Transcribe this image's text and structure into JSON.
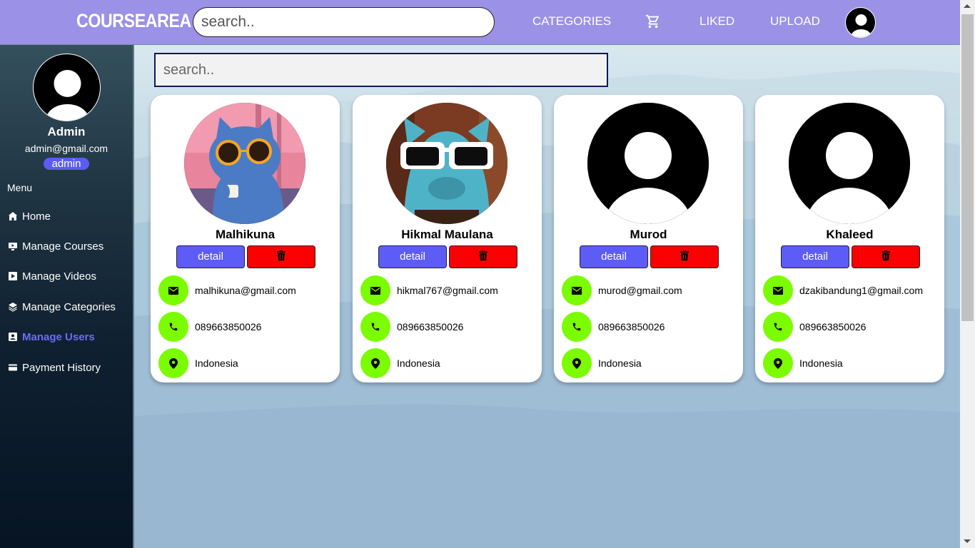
{
  "navbar": {
    "logo": "COURSEAREA",
    "search_placeholder": "search..",
    "links": {
      "categories": "CATEGORIES",
      "liked": "LIKED",
      "upload": "UPLOAD"
    },
    "cart_icon": "cart-icon",
    "color": "#9b91e6"
  },
  "sidebar": {
    "user": {
      "name": "Admin",
      "email": "admin@gmail.com",
      "role": "admin"
    },
    "menu_title": "Menu",
    "items": [
      {
        "label": "Home",
        "icon": "home-icon",
        "active": false
      },
      {
        "label": "Manage Courses",
        "icon": "monitor-icon",
        "active": false
      },
      {
        "label": "Manage Videos",
        "icon": "play-icon",
        "active": false
      },
      {
        "label": "Manage Categories",
        "icon": "layers-icon",
        "active": false
      },
      {
        "label": "Manage Users",
        "icon": "user-card-icon",
        "active": true
      },
      {
        "label": "Payment History",
        "icon": "credit-card-icon",
        "active": false
      }
    ],
    "active_color": "#6a6cf5"
  },
  "main": {
    "search_placeholder": "search.."
  },
  "users": [
    {
      "name": "Malhikuna",
      "email": "malhikuna@gmail.com",
      "phone": "089663850026",
      "country": "Indonesia",
      "photo": "cat-sunglasses-pink"
    },
    {
      "name": "Hikmal Maulana",
      "email": "hikmal767@gmail.com",
      "phone": "089663850026",
      "country": "Indonesia",
      "photo": "cat-sunglasses-white"
    },
    {
      "name": "Murod",
      "email": "murod@gmail.com",
      "phone": "089663850026",
      "country": "Indonesia",
      "photo": "default-avatar"
    },
    {
      "name": "Khaleed",
      "email": "dzakibandung1@gmail.com",
      "phone": "089663850026",
      "country": "Indonesia",
      "photo": "default-avatar"
    }
  ],
  "card_buttons": {
    "detail": "detail",
    "delete_icon": "trash-icon"
  },
  "colors": {
    "detail_button": "#5e5cf6",
    "delete_button": "#fb0000",
    "info_dot": "#7bfc00"
  }
}
